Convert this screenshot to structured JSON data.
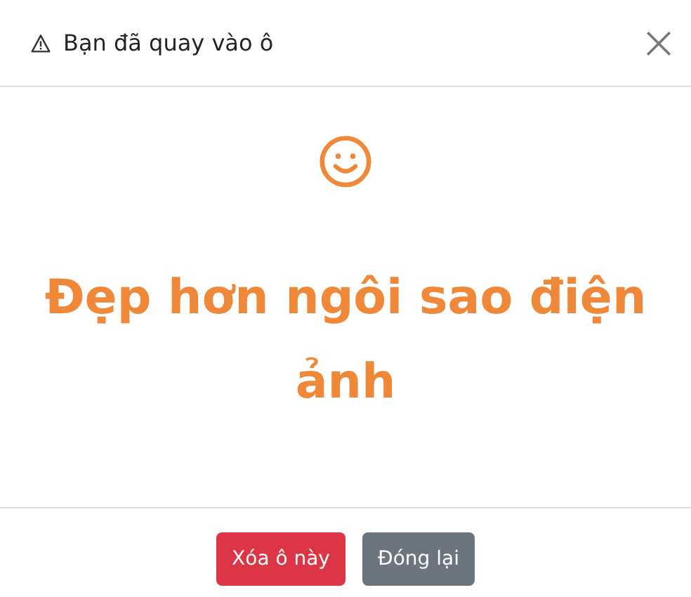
{
  "dialog": {
    "title": "Bạn đã quay vào ô",
    "message": "Đẹp hơn ngôi sao điện ảnh"
  },
  "buttons": [
    {
      "label": "Xóa ô này",
      "kind": "danger"
    },
    {
      "label": "Đóng lại",
      "kind": "secondary"
    }
  ]
}
